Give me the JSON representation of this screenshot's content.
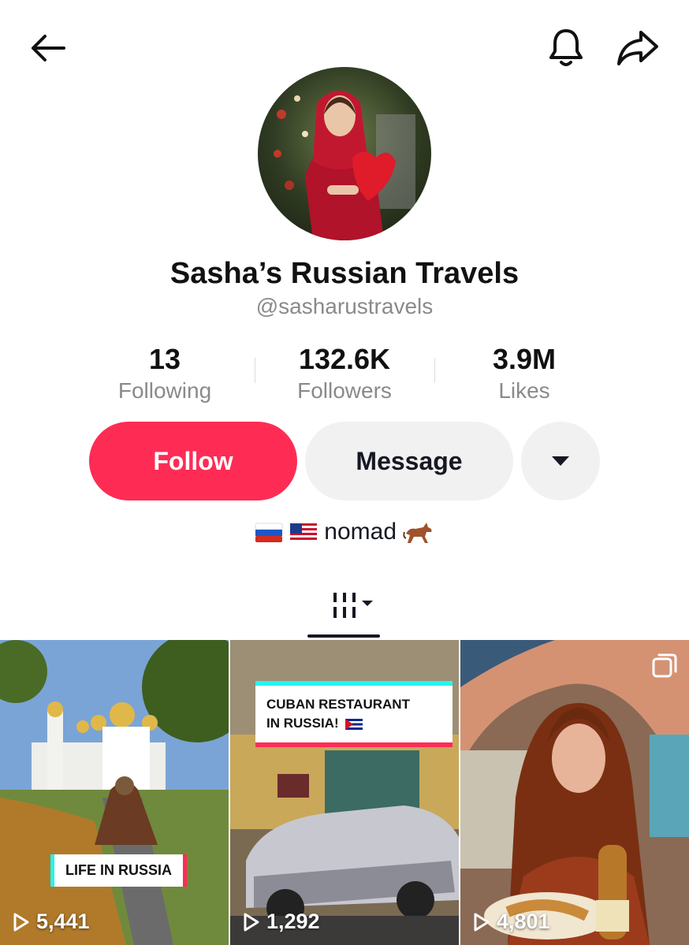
{
  "header": {
    "back_icon": "arrow-left-icon",
    "bell_icon": "bell-icon",
    "share_icon": "share-arrow-icon"
  },
  "profile": {
    "name": "Sasha’s Russian Travels",
    "handle": "@sasharustravels",
    "bio": "nomad"
  },
  "stats": [
    {
      "value": "13",
      "label": "Following"
    },
    {
      "value": "132.6K",
      "label": "Followers"
    },
    {
      "value": "3.9M",
      "label": "Likes"
    }
  ],
  "actions": {
    "follow_label": "Follow",
    "message_label": "Message",
    "more_icon": "caret-down-icon"
  },
  "tabs": {
    "grid_icon": "grid-filter-icon"
  },
  "videos": [
    {
      "views": "5,441",
      "caption": "LIFE IN RUSSIA"
    },
    {
      "views": "1,292",
      "caption_line1": "CUBAN RESTAURANT",
      "caption_line2": "IN RUSSIA!"
    },
    {
      "views": "4,801"
    }
  ],
  "colors": {
    "accent": "#fe2c55",
    "button_gray": "#f1f1f2",
    "text_secondary": "#8a8a8a"
  }
}
